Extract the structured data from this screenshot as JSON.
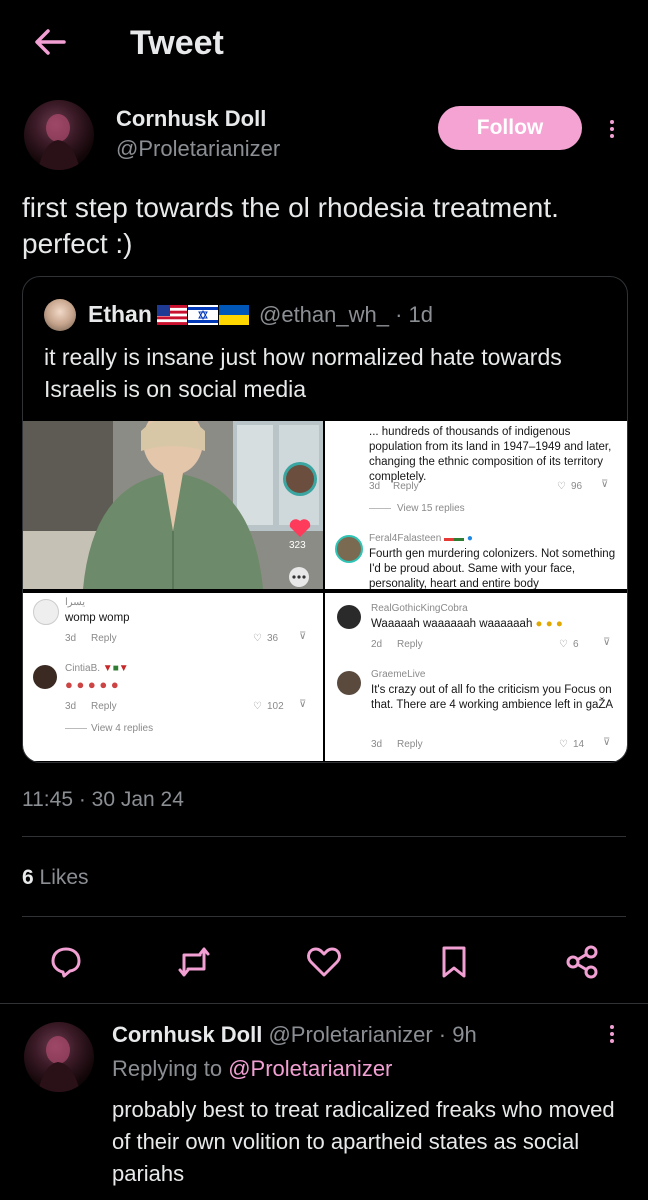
{
  "header": {
    "title": "Tweet"
  },
  "tweet": {
    "author_name": "Cornhusk Doll",
    "author_handle": "@Proletarianizer",
    "follow_label": "Follow",
    "text": "first step towards the ol rhodesia treatment.\nperfect :)",
    "timestamp": "11:45 · 30 Jan 24",
    "likes_count": "6",
    "likes_label": "Likes"
  },
  "quote": {
    "name": "Ethan",
    "handle": "@ethan_wh_",
    "age": "· 1d",
    "text": "it really is insane just how normalized hate towards Israelis is on social media",
    "flags": [
      "us-flag",
      "israel-flag",
      "ukraine-flag"
    ],
    "images": {
      "top_left": {
        "counter": "323"
      },
      "top_right": {
        "comment_top": "... hundreds of thousands of indigenous population from its land in 1947–1949 and later, changing the ethnic composition of its territory completely.",
        "meta1_age": "3d",
        "meta1_reply": "Reply",
        "meta1_likes": "96",
        "view_replies": "View 15 replies",
        "user2": "Feral4Falasteen",
        "comment2": "Fourth gen murdering colonizers. Not something I'd be proud about. Same with your face, personality, heart and entire body"
      },
      "bottom_left": {
        "user1": "يسرا",
        "comment1": "womp womp",
        "meta1_age": "3d",
        "meta1_reply": "Reply",
        "meta1_likes": "36",
        "user2": "CintiaB.",
        "meta2_age": "3d",
        "meta2_reply": "Reply",
        "meta2_likes": "102",
        "view_replies": "View 4 replies"
      },
      "bottom_right": {
        "user1": "RealGothicKingCobra",
        "comment1": "Waaaaah waaaaaah waaaaaah",
        "meta1_age": "2d",
        "meta1_reply": "Reply",
        "meta1_likes": "6",
        "user2": "GraemeLive",
        "comment2": "It's crazy out of all fo the criticism you Focus on that. There are 4 working ambience left in gaŽA",
        "meta2_age": "3d",
        "meta2_reply": "Reply",
        "meta2_likes": "14"
      }
    }
  },
  "actions": [
    "reply-icon",
    "retweet-icon",
    "like-icon",
    "bookmark-icon",
    "share-icon"
  ],
  "reply": {
    "author_name": "Cornhusk Doll",
    "author_handle": "@Proletarianizer",
    "age": "· 9h",
    "replying_prefix": "Replying to",
    "replying_to": "@Proletarianizer",
    "text": "probably best to treat radicalized freaks who moved of their own volition to apartheid states as social pariahs"
  },
  "colors": {
    "accent": "#f5a3d3",
    "background": "#000000",
    "text": "#e7e9ea",
    "muted": "#8b8f94"
  }
}
